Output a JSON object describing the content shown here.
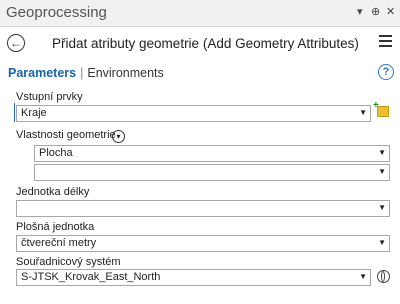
{
  "window": {
    "title": "Geoprocessing",
    "pin": "▾",
    "pin2": "⊕",
    "close": "✕"
  },
  "header": {
    "tool_name": "Přidat atributy geometrie (Add Geometry Attributes)"
  },
  "tabs": {
    "parameters": "Parameters",
    "environments": "Environments"
  },
  "params": {
    "input_label": "Vstupní prvky",
    "input_value": "Kraje",
    "geom_props_label": "Vlastnosti geometrie",
    "geom_prop_1": "Plocha",
    "geom_prop_2": "",
    "length_unit_label": "Jednotka délky",
    "length_unit_value": "",
    "area_unit_label": "Plošná jednotka",
    "area_unit_value": "čtvereční metry",
    "crs_label": "Souřadnicový systém",
    "crs_value": "S-JTSK_Krovak_East_North"
  },
  "colors": {
    "accent": "#1a63a8"
  }
}
